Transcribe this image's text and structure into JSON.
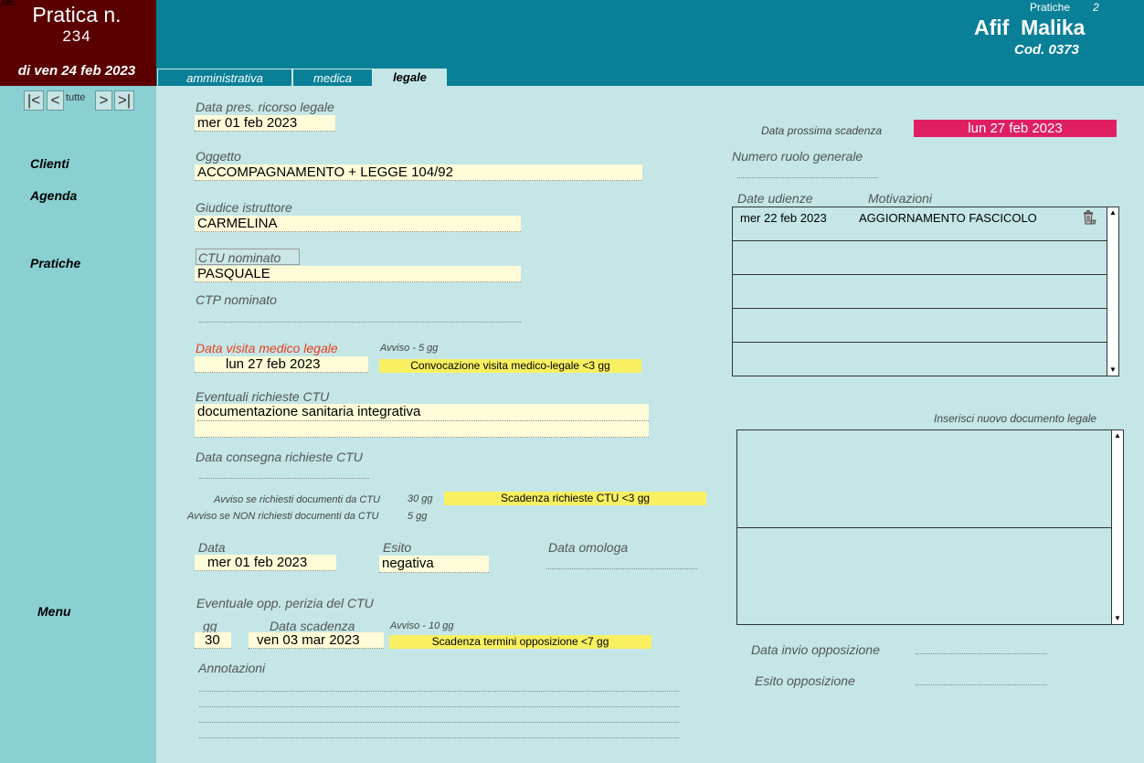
{
  "header": {
    "tiny_label": "Altri",
    "pratica_title": "Pratica n.",
    "pratica_number": "234",
    "pratica_date": "di ven 24 feb 2023",
    "pratiche_label": "Pratiche",
    "pratiche_count": "2",
    "client_name": "Afif  Malika",
    "client_code": "Cod. 0373"
  },
  "tabs": [
    {
      "label": "amministrativa",
      "active": false
    },
    {
      "label": "medica",
      "active": false
    },
    {
      "label": "legale",
      "active": true
    }
  ],
  "nav": {
    "first": "|<",
    "prev": "<",
    "all": "tutte",
    "next": ">",
    "last": ">|"
  },
  "sidebar": {
    "items": [
      "Clienti",
      "Agenda",
      "Pratiche",
      "Menu"
    ]
  },
  "form": {
    "ricorso_label": "Data pres. ricorso legale",
    "ricorso_value": "mer 01 feb 2023",
    "oggetto_label": "Oggetto",
    "oggetto_value": "ACCOMPAGNAMENTO + LEGGE 104/92",
    "giudice_label": "Giudice istruttore",
    "giudice_value": "CARMELINA",
    "ctu_label": "CTU nominato",
    "ctu_value": " PASQUALE",
    "ctp_label": "CTP nominato",
    "ctp_value": "",
    "visita_label": "Data visita medico legale",
    "visita_avviso": "Avviso - 5 gg",
    "visita_value": "lun 27 feb 2023",
    "visita_note": "Convocazione visita medico-legale <3 gg",
    "richieste_label": "Eventuali richieste CTU",
    "richieste_value": "documentazione sanitaria integrativa",
    "consegna_label": "Data consegna richieste CTU",
    "consegna_value": "",
    "avviso_si_label": "Avviso se richiesti documenti da CTU",
    "avviso_si_value": "30 gg",
    "avviso_si_note": "Scadenza richieste CTU <3 gg",
    "avviso_no_label": "Avviso se NON richiesti documenti da CTU",
    "avviso_no_value": "5 gg",
    "data_label": "Data",
    "data_value": "mer 01 feb 2023",
    "esito_label": "Esito",
    "esito_value": "negativa",
    "omologa_label": "Data omologa",
    "omologa_value": "",
    "perizia_label": "Eventuale opp. perizia del CTU",
    "gg_label": "gg",
    "gg_value": "30",
    "scadenza_label": "Data scadenza",
    "scadenza_avviso": "Avviso - 10 gg",
    "scadenza_value": "ven 03 mar 2023",
    "scadenza_note": "Scadenza termini opposizione <7 gg",
    "annotazioni_label": "Annotazioni"
  },
  "right": {
    "prossima_label": "Data prossima scadenza",
    "prossima_value": "lun 27 feb 2023",
    "ruolo_label": "Numero ruolo generale",
    "ruolo_value": "",
    "udienze_label": "Date udienze",
    "motivazioni_label": "Motivazioni",
    "hearings": [
      {
        "date": "mer 22 feb 2023",
        "reason": "AGGIORNAMENTO FASCICOLO"
      }
    ],
    "nuovo_doc_label": "Inserisci nuovo documento legale",
    "invio_label": "Data invio opposizione",
    "invio_value": "",
    "esito_opp_label": "Esito opposizione",
    "esito_opp_value": ""
  },
  "colors": {
    "header": "#0a8098",
    "pratica_box": "#5a0000",
    "sidebar": "#8ad0d3",
    "main_bg": "#c4e6e6",
    "field_bg": "#fefbd8",
    "note_yellow": "#f8f060",
    "deadline": "#e01f63",
    "alert_label": "#e8401c"
  }
}
